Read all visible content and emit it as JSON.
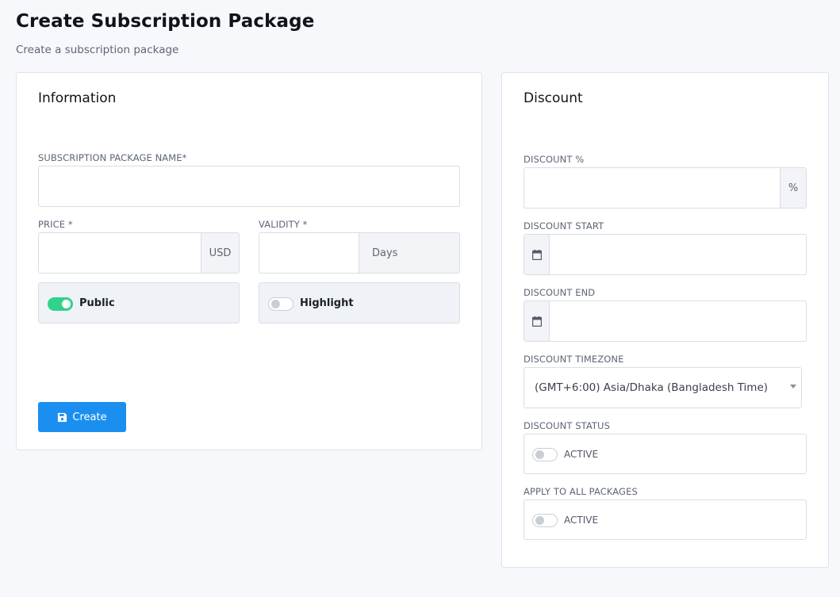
{
  "header": {
    "title": "Create Subscription Package",
    "subtitle": "Create a subscription package"
  },
  "information": {
    "title": "Information",
    "name_label": "SUBSCRIPTION PACKAGE NAME*",
    "name_value": "",
    "price_label": "PRICE *",
    "price_value": "",
    "price_addon": "USD",
    "validity_label": "VALIDITY *",
    "validity_value": "",
    "validity_addon": "Days",
    "public_label": "Public",
    "public_on": true,
    "highlight_label": "Highlight",
    "highlight_on": false,
    "create_label": "Create",
    "create_icon": "save-icon"
  },
  "discount": {
    "title": "Discount",
    "percent_label": "DISCOUNT %",
    "percent_value": "",
    "percent_addon": "%",
    "start_label": "DISCOUNT START",
    "start_value": "",
    "end_label": "DISCOUNT END",
    "end_value": "",
    "date_icon": "calendar-icon",
    "timezone_label": "DISCOUNT TIMEZONE",
    "timezone_value": "(GMT+6:00) Asia/Dhaka (Bangladesh Time)",
    "status_label": "DISCOUNT STATUS",
    "status_text": "ACTIVE",
    "status_on": false,
    "apply_label": "APPLY TO ALL PACKAGES",
    "apply_text": "ACTIVE",
    "apply_on": false
  },
  "colors": {
    "primary": "#1b8ff0",
    "toggle_on": "#2fd38a",
    "page_background": "#f6f8fc"
  }
}
